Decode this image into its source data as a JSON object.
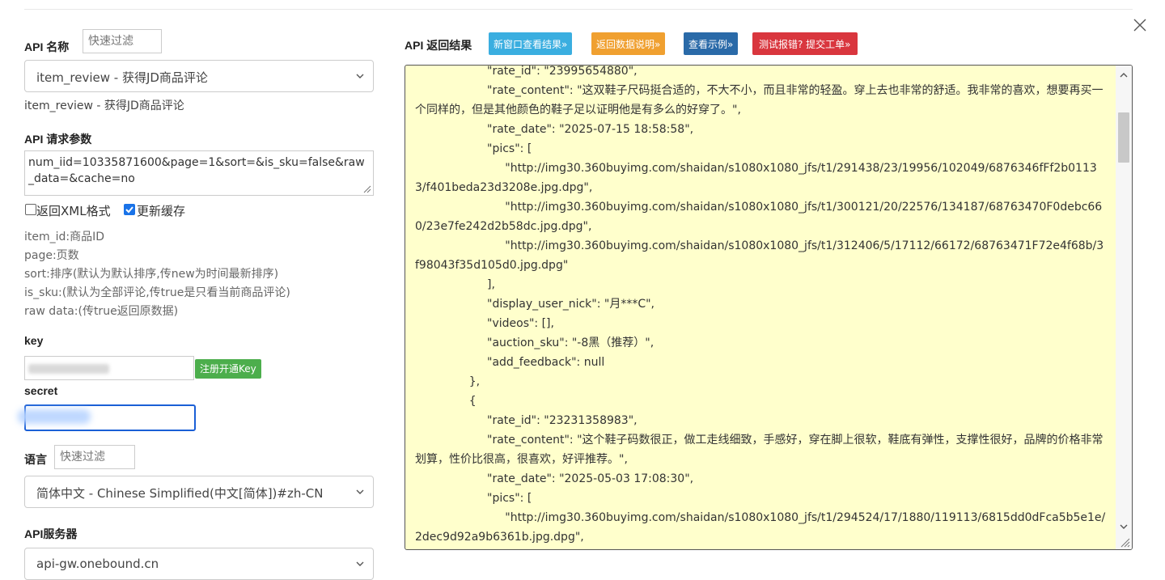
{
  "api_name": {
    "label": "API 名称",
    "filter_placeholder": "快速过滤",
    "selected": "item_review - 获得JD商品评论",
    "description": "item_review - 获得JD商品评论"
  },
  "request_params": {
    "label": "API 请求参数",
    "value": "num_iid=10335871600&page=1&sort=&is_sku=false&raw_data=&cache=no",
    "options": [
      {
        "label": "返回XML格式",
        "checked": false
      },
      {
        "label": "更新缓存",
        "checked": true
      }
    ],
    "notes": [
      "item_id:商品ID",
      "page:页数",
      "sort:排序(默认为默认排序,传new为时间最新排序)",
      "is_sku:(默认为全部评论,传true是只看当前商品评论)",
      "raw data:(传true返回原数据)"
    ]
  },
  "key": {
    "label": "key",
    "register_button": "注册开通Key"
  },
  "secret": {
    "label": "secret"
  },
  "language": {
    "label": "语言",
    "filter_placeholder": "快速过滤",
    "selected": "简体中文 - Chinese Simplified(中文[简体])#zh-CN"
  },
  "server": {
    "label": "API服务器",
    "selected": "api-gw.onebound.cn"
  },
  "result": {
    "label": "API 返回结果",
    "buttons": [
      {
        "label": "新窗口查看结果»",
        "color": "#3aaee0"
      },
      {
        "label": "返回数据说明»",
        "color": "#f0a030"
      },
      {
        "label": "查看示例»",
        "color": "#2a6aa8"
      },
      {
        "label": "测试报错? 提交工单»",
        "color": "#d9363e"
      }
    ],
    "content": "                    \"rate_id\": \"23995654880\",\n                    \"rate_content\": \"这双鞋子尺码挺合适的，不大不小，而且非常的轻盈。穿上去也非常的舒适。我非常的喜欢，想要再买一个同样的，但是其他颜色的鞋子足以证明他是有多么的好穿了。\",\n                    \"rate_date\": \"2025-07-15 18:58:58\",\n                    \"pics\": [\n                         \"http://img30.360buyimg.com/shaidan/s1080x1080_jfs/t1/291438/23/19956/102049/6876346fFf2b01133/f401beda23d3208e.jpg.dpg\",\n                         \"http://img30.360buyimg.com/shaidan/s1080x1080_jfs/t1/300121/20/22576/134187/68763470F0debc660/23e7fe242d2b58dc.jpg.dpg\",\n                         \"http://img30.360buyimg.com/shaidan/s1080x1080_jfs/t1/312406/5/17112/66172/68763471F72e4f68b/3f98043f35d105d0.jpg.dpg\"\n                    ],\n                    \"display_user_nick\": \"月***C\",\n                    \"videos\": [],\n                    \"auction_sku\": \"-8黑（推荐）\",\n                    \"add_feedback\": null\n               },\n               {\n                    \"rate_id\": \"23231358983\",\n                    \"rate_content\": \"这个鞋子码数很正，做工走线细致，手感好，穿在脚上很软，鞋底有弹性，支撑性很好，品牌的价格非常划算，性价比很高，很喜欢，好评推荐。\",\n                    \"rate_date\": \"2025-05-03 17:08:30\",\n                    \"pics\": [\n                         \"http://img30.360buyimg.com/shaidan/s1080x1080_jfs/t1/294524/17/1880/119113/6815dd0dFca5b5e1e/2dec9d92a9b6361b.jpg.dpg\","
  }
}
